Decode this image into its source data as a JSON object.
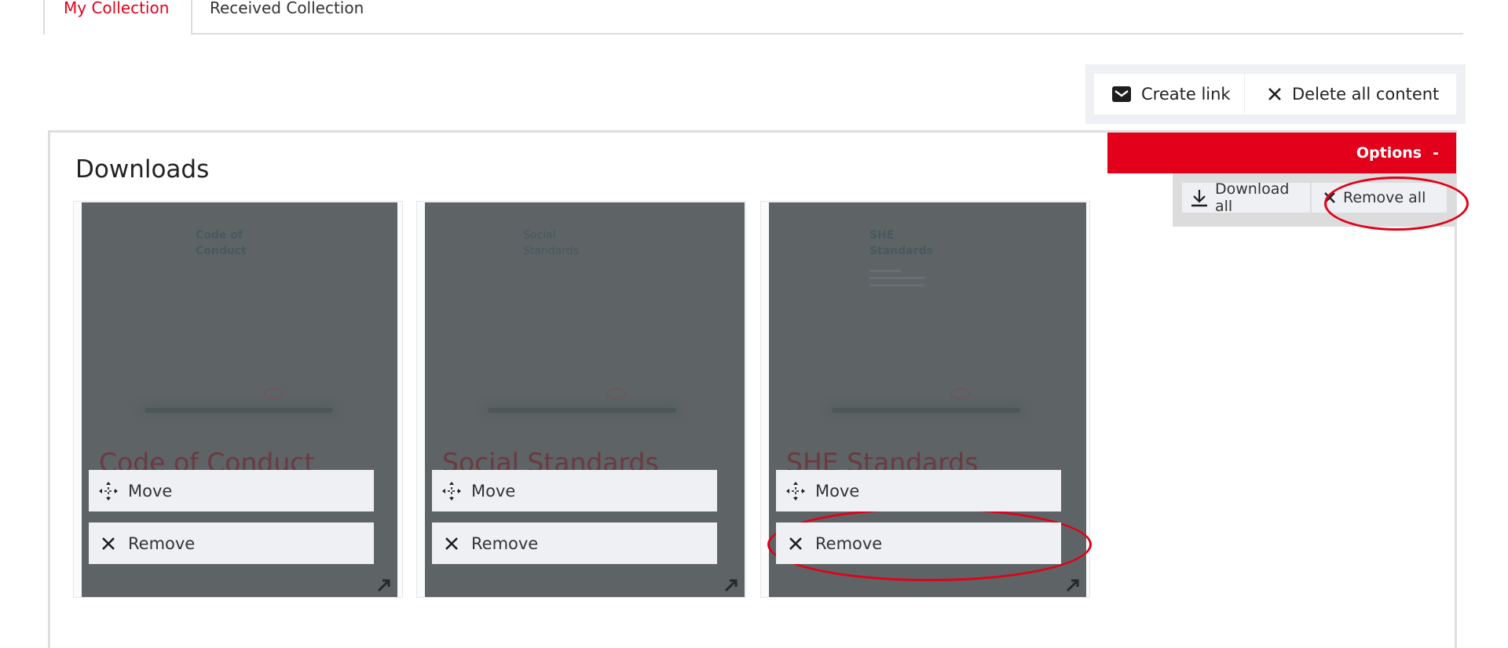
{
  "tabs": [
    {
      "label": "My Collection",
      "active": true
    },
    {
      "label": "Received Collection",
      "active": false
    }
  ],
  "actions": {
    "create_link": {
      "label": "Create link",
      "icon": "envelope-icon"
    },
    "delete_all": {
      "label": "Delete all content",
      "icon": "close-icon"
    }
  },
  "panel": {
    "title": "Downloads"
  },
  "options": {
    "label": "Options",
    "toggle_symbol": "-",
    "accent_color": "#e2001a",
    "download_all": {
      "label": "Download all",
      "icon": "download-icon"
    },
    "remove_all": {
      "label": "Remove all",
      "icon": "close-icon"
    }
  },
  "cards": [
    {
      "cover_title_line1": "Code of",
      "cover_title_line2": "Conduct",
      "title": "Code of Conduct",
      "move_label": "Move",
      "remove_label": "Remove"
    },
    {
      "cover_title_line1": "Social",
      "cover_title_line2": "Standards",
      "title": "Social Standards",
      "move_label": "Move",
      "remove_label": "Remove"
    },
    {
      "cover_title_line1": "SHE",
      "cover_title_line2": "Standards",
      "title": "SHE Standards",
      "move_label": "Move",
      "remove_label": "Remove"
    }
  ],
  "annotations": {
    "highlight_color": "#e2001a",
    "highlighted": [
      "Remove all",
      "Remove (SHE Standards)"
    ]
  }
}
